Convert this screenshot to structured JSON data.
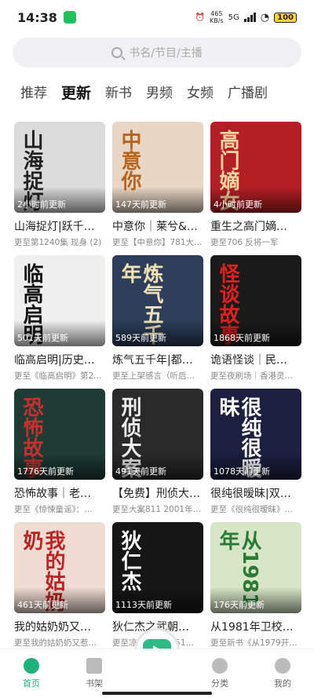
{
  "status": {
    "time": "14:38",
    "speed_top": "465",
    "speed_bottom": "KB/s",
    "network": "5G",
    "battery": "100"
  },
  "search": {
    "placeholder": "书名/节目/主播"
  },
  "tabs": [
    "推荐",
    "更新",
    "新书",
    "男频",
    "女频",
    "广播剧"
  ],
  "active_tab": "更新",
  "cards": [
    {
      "cover_text": "山海捉灯",
      "updated": "2小时前更新",
      "title": "山海捉灯|跃千…",
      "sub": "更至第1240集 现身 (2)",
      "bg": "#dcdcdc",
      "fg": "#222"
    },
    {
      "cover_text": "中意你",
      "updated": "147天前更新",
      "title": "中意你｜莱兮&…",
      "sub": "更至【中意你】781大…",
      "bg": "#e9d6c4",
      "fg": "#b5651d"
    },
    {
      "cover_text": "高门嫡女",
      "updated": "4小时前更新",
      "title": "重生之高门嫡…",
      "sub": "更至706 反将一军",
      "bg": "#b41f26",
      "fg": "#ffd6a0"
    },
    {
      "cover_text": "临高启明",
      "updated": "501天前更新",
      "title": "临高启明|历史…",
      "sub": "更至《临高启明》第2…",
      "bg": "#efefef",
      "fg": "#111"
    },
    {
      "cover_text": "炼气五千年",
      "updated": "589天前更新",
      "title": "炼气五千年|都…",
      "sub": "更至上架感言（听后…",
      "bg": "#2d3e5a",
      "fg": "#f0e2b6"
    },
    {
      "cover_text": "怪谈故事",
      "updated": "1868天前更新",
      "title": "诡语怪谈｜民…",
      "sub": "更至夜刷场｜香港灵…",
      "bg": "#1a1a1a",
      "fg": "#e02020"
    },
    {
      "cover_text": "恐怖故事",
      "updated": "1776天前更新",
      "title": "恐怖故事｜老…",
      "sub": "更至《惊悚童谣》：…",
      "bg": "#1e3b34",
      "fg": "#c83030"
    },
    {
      "cover_text": "刑侦大案",
      "updated": "491天前更新",
      "title": "【免费】刑侦大…",
      "sub": "更至大案811 2001年…",
      "bg": "#2a2a2a",
      "fg": "#eeeeee"
    },
    {
      "cover_text": "很纯很暧昧",
      "updated": "1078天前更新",
      "title": "很纯很暧昧|双…",
      "sub": "更至《很纯很暧昧》…",
      "bg": "#1c1f3f",
      "fg": "#ffffff"
    },
    {
      "cover_text": "我的姑奶奶",
      "updated": "461天前更新",
      "title": "我的姑奶奶又…",
      "sub": "更至我的姑奶奶又惹…",
      "bg": "#f0dcd2",
      "fg": "#c02222"
    },
    {
      "cover_text": "狄仁杰",
      "updated": "1113天前更新",
      "title": "狄仁杰之武朝…",
      "sub": "更至凉州大案：151…",
      "bg": "#161616",
      "fg": "#ffffff"
    },
    {
      "cover_text": "从1981年",
      "updated": "176天前更新",
      "title": "从1981年卫校…",
      "sub": "更至新书《从1979开…",
      "bg": "#d7e6c6",
      "fg": "#2a7a36"
    }
  ],
  "bottom_nav": [
    {
      "label": "首页",
      "icon": "home-icon",
      "active": true
    },
    {
      "label": "书架",
      "icon": "bookshelf-icon",
      "active": false
    },
    {
      "label": "分类",
      "icon": "category-icon",
      "active": false
    },
    {
      "label": "我的",
      "icon": "profile-icon",
      "active": false
    }
  ],
  "colors": {
    "accent": "#1db27a"
  }
}
